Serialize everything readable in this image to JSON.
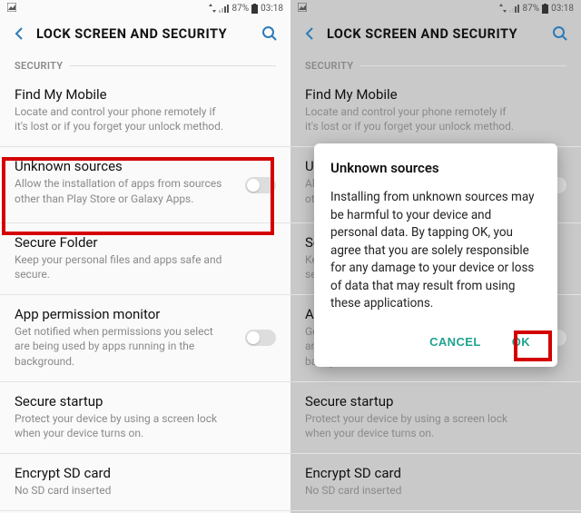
{
  "status": {
    "battery_pct": "87%",
    "time": "03:18"
  },
  "header": {
    "title": "LOCK SCREEN AND SECURITY"
  },
  "section_label": "SECURITY",
  "items": {
    "find": {
      "title": "Find My Mobile",
      "desc": "Locate and control your phone remotely if it's lost or if you forget your unlock method."
    },
    "unknown": {
      "title": "Unknown sources",
      "desc": "Allow the installation of apps from sources other than Play Store or Galaxy Apps."
    },
    "folder": {
      "title": "Secure Folder",
      "desc": "Keep your personal files and apps safe and secure."
    },
    "perm": {
      "title": "App permission monitor",
      "desc": "Get notified when permissions you select are being used by apps running in the background."
    },
    "startup": {
      "title": "Secure startup",
      "desc": "Protect your device by using a screen lock when your device turns on."
    },
    "sd": {
      "title": "Encrypt SD card",
      "desc": "No SD card inserted"
    }
  },
  "dialog": {
    "title": "Unknown sources",
    "body": "Installing from unknown sources may be harmful to your device and personal data. By tapping OK, you agree that you are solely responsible for any damage to your device or loss of data that may result from using these applications.",
    "cancel": "CANCEL",
    "ok": "OK"
  }
}
